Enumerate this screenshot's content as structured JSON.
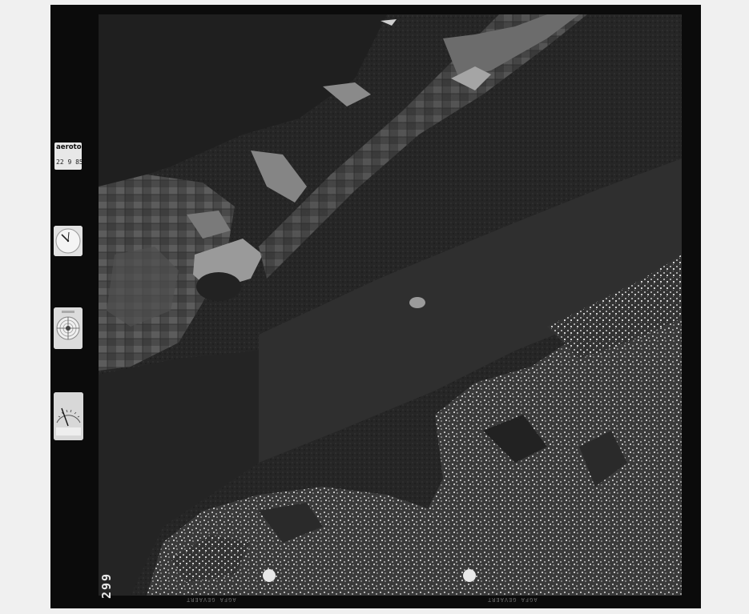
{
  "image": {
    "description_type": "aerial photograph",
    "frame_number": "299",
    "logo": {
      "text": "aerotop",
      "date": "22 9 85"
    },
    "edge_annotations": [
      "AGFA GEVAERT",
      "AGFA GEVAERT"
    ],
    "instruments": [
      {
        "name": "clock"
      },
      {
        "name": "level-bubble"
      },
      {
        "name": "altimeter"
      }
    ],
    "colors": {
      "film_border": "#0b0b0b",
      "background": "#f0f0f0",
      "forest": "#2a2a2a",
      "fields": "#5a5a5a",
      "urban": "#8a8a8a"
    }
  }
}
